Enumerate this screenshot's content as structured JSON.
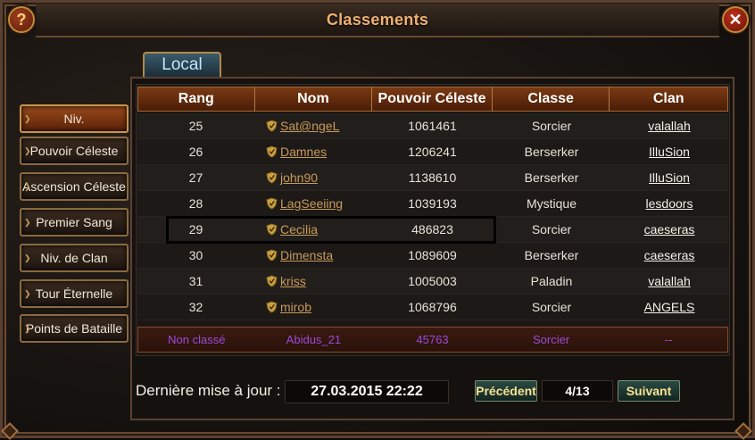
{
  "window": {
    "title": "Classements"
  },
  "tabs": {
    "local": "Local"
  },
  "sidebar": {
    "items": [
      {
        "label": "Niv.",
        "active": true
      },
      {
        "label": "Pouvoir Céleste",
        "active": false
      },
      {
        "label": "Ascension Céleste",
        "active": false
      },
      {
        "label": "Premier Sang",
        "active": false
      },
      {
        "label": "Niv. de Clan",
        "active": false
      },
      {
        "label": "Tour Éternelle",
        "active": false
      },
      {
        "label": "Points de Bataille",
        "active": false
      }
    ]
  },
  "table": {
    "headers": {
      "rank": "Rang",
      "name": "Nom",
      "power": "Pouvoir Céleste",
      "class": "Classe",
      "clan": "Clan"
    },
    "rows": [
      {
        "rank": "25",
        "name": "Sat@ngeL",
        "power": "1061461",
        "class": "Sorcier",
        "clan": "valallah"
      },
      {
        "rank": "26",
        "name": "Damnes",
        "power": "1206241",
        "class": "Berserker",
        "clan": "IlluSion"
      },
      {
        "rank": "27",
        "name": "john90",
        "power": "1138610",
        "class": "Berserker",
        "clan": "IlluSion"
      },
      {
        "rank": "28",
        "name": "LagSeeiing",
        "power": "1039193",
        "class": "Mystique",
        "clan": "lesdoors"
      },
      {
        "rank": "29",
        "name": "Cecilia",
        "power": "486823",
        "class": "Sorcier",
        "clan": "caeseras"
      },
      {
        "rank": "30",
        "name": "Dimensta",
        "power": "1089609",
        "class": "Berserker",
        "clan": "caeseras"
      },
      {
        "rank": "31",
        "name": "kriss",
        "power": "1005003",
        "class": "Paladin",
        "clan": "valallah"
      },
      {
        "rank": "32",
        "name": "mirob",
        "power": "1068796",
        "class": "Sorcier",
        "clan": "ANGELS"
      }
    ],
    "self": {
      "rank": "Non classé",
      "name": "Abidus_21",
      "power": "45763",
      "class": "Sorcier",
      "clan": "--"
    }
  },
  "footer": {
    "last_update_label": "Dernière mise à jour :",
    "last_update_value": "27.03.2015 22:22",
    "prev_label": "Précédent",
    "page": "4/13",
    "next_label": "Suivant"
  },
  "colors": {
    "accent": "#f0b070",
    "name_link": "#c89a5a",
    "self_row_text": "#9a4ad8"
  },
  "icons": {
    "help": "question-icon",
    "close": "close-icon",
    "row_badge": "shield-icon"
  }
}
